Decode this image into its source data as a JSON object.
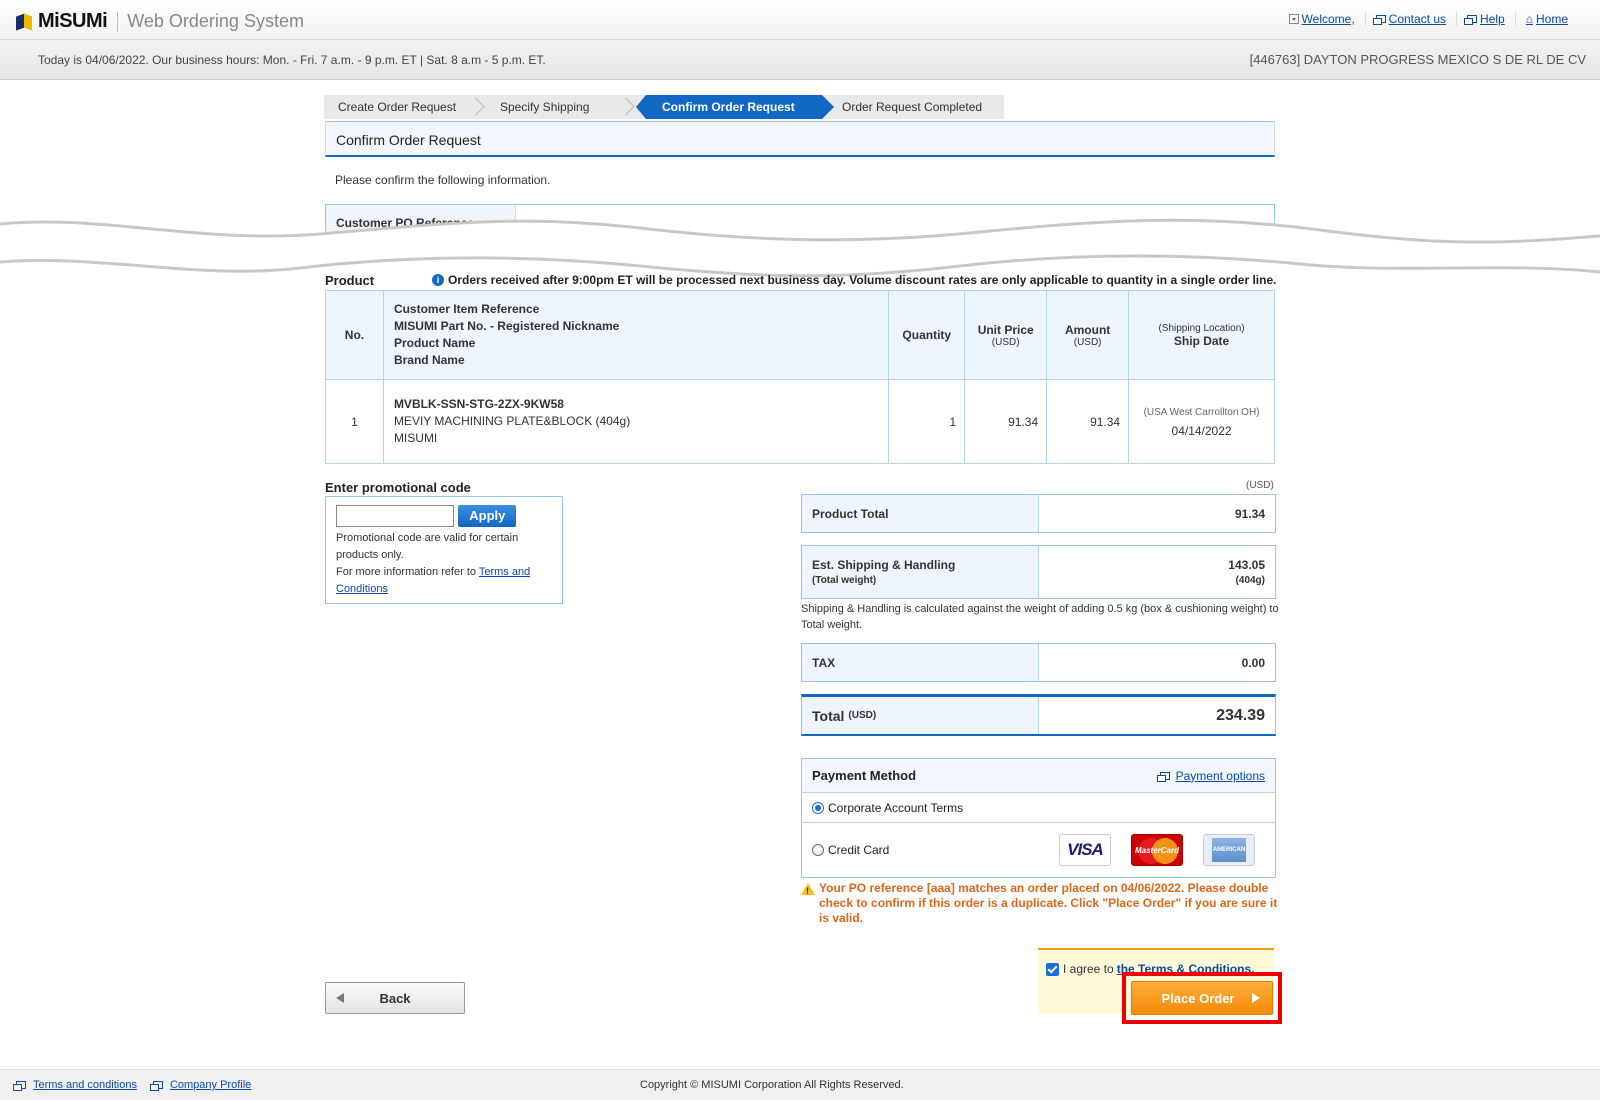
{
  "header": {
    "brand": "MiSUMi",
    "system_name": "Web Ordering System",
    "links": {
      "welcome": "Welcome,",
      "contact": "Contact us",
      "help": "Help",
      "home": "Home"
    },
    "today_text": "Today is 04/06/2022.  Our business hours: Mon. - Fri. 7 a.m. - 9 p.m. ET | Sat. 8 a.m - 5 p.m. ET.",
    "account": "[446763] DAYTON PROGRESS MEXICO S DE RL DE CV"
  },
  "steps": [
    "Create Order Request",
    "Specify Shipping",
    "Confirm Order Request",
    "Order Request Completed"
  ],
  "active_step": 2,
  "page_title": "Confirm Order Request",
  "confirm_text": "Please confirm the following information.",
  "po_label": "Customer PO Reference",
  "product_section": {
    "title": "Product",
    "note": "Orders received after 9:00pm ET will be processed next business day. Volume discount rates are only applicable to quantity in a single order line.",
    "columns": {
      "no": "No.",
      "desc_lines": [
        "Customer Item Reference",
        "MISUMI Part No. - Registered Nickname",
        "Product Name",
        "Brand Name"
      ],
      "quantity": "Quantity",
      "unit_price": "Unit Price",
      "amount": "Amount",
      "currency": "(USD)",
      "ship_location": "(Shipping Location)",
      "ship_date": "Ship Date"
    },
    "rows": [
      {
        "no": "1",
        "part_no": "MVBLK-SSN-STG-2ZX-9KW58",
        "product_name": "MEVIY MACHINING PLATE&BLOCK  (404g)",
        "brand": "MISUMI",
        "quantity": "1",
        "unit_price": "91.34",
        "amount": "91.34",
        "location": "(USA West Carrollton OH)",
        "ship_date": "04/14/2022"
      }
    ]
  },
  "promo": {
    "title": "Enter promotional code",
    "input_value": "",
    "apply_label": "Apply",
    "note1": "Promotional code are valid for certain products only.",
    "note2": "For more information refer to ",
    "terms_link": "Terms and Conditions"
  },
  "totals": {
    "currency_note": "(USD)",
    "product_total_label": "Product Total",
    "product_total_value": "91.34",
    "shipping_label": "Est. Shipping & Handling",
    "shipping_sub": "(Total weight)",
    "shipping_value": "143.05",
    "shipping_weight": "(404g)",
    "shipping_note": "Shipping & Handling is calculated against the weight of adding 0.5 kg (box & cushioning weight) to Total weight.",
    "tax_label": "TAX",
    "tax_value": "0.00",
    "total_label": "Total",
    "total_unit": "(USD)",
    "total_value": "234.39"
  },
  "payment": {
    "title": "Payment Method",
    "options_link": "Payment options",
    "corporate_label": "Corporate Account Terms",
    "credit_label": "Credit Card",
    "selected": "corporate",
    "cards": [
      "VISA",
      "MasterCard",
      "AMERICAN EXPRESS"
    ]
  },
  "warning": "Your PO reference [aaa] matches an order placed on 04/06/2022. Please double check to confirm if this order is a duplicate. Click \"Place Order\" if you are sure it is valid.",
  "agree": {
    "checked": true,
    "text": "I agree to",
    "link": "the Terms & Conditions."
  },
  "buttons": {
    "back": "Back",
    "place_order": "Place Order"
  },
  "footer": {
    "terms": "Terms and conditions",
    "company": "Company Profile",
    "copyright": "Copyright © MISUMI Corporation All Rights Reserved."
  },
  "colors": {
    "accent_blue": "#1068c4",
    "order_orange": "#f58a07",
    "warning_orange": "#e0661a",
    "highlight_red": "#ee0000"
  }
}
